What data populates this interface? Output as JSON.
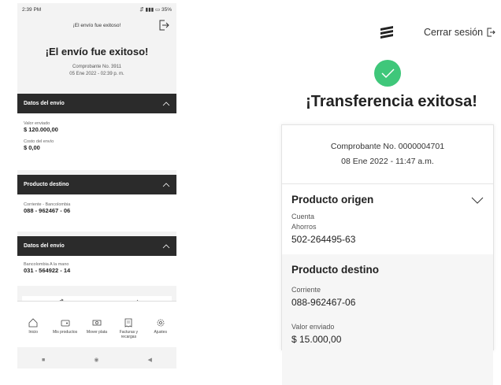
{
  "phone": {
    "status": {
      "time": "2:39 PM",
      "icons": "⇵ ▮▮▮ ▭ 35%"
    },
    "topbar_title": "¡El envío fue exitoso!",
    "title": "¡El envío fue exitoso!",
    "receipt": {
      "number": "Comprobante No. 3911",
      "date": "05 Ene 2022 - 02:39 p. m."
    },
    "sections": [
      {
        "title": "Datos del envío",
        "fields": [
          {
            "label": "Valor enviado",
            "value": "$ 120.000,00"
          },
          {
            "label": "Costo del envío",
            "value": "$ 0,00"
          }
        ]
      },
      {
        "title": "Producto destino",
        "fields": [
          {
            "label": "Corriente - Bancolombia",
            "value": "088 - 962467 - 06"
          }
        ]
      },
      {
        "title": "Datos del envío",
        "fields": [
          {
            "label": "Bancolombia A la mano",
            "value": "031 - 564922 - 14"
          }
        ]
      }
    ],
    "tabs": [
      {
        "label": "Inicio",
        "icon": "home-icon"
      },
      {
        "label": "Mis productos",
        "icon": "wallet-icon"
      },
      {
        "label": "Mover plata",
        "icon": "money-icon"
      },
      {
        "label": "Facturas y recargas",
        "icon": "bill-icon"
      },
      {
        "label": "Ajustes",
        "icon": "gear-icon"
      }
    ],
    "nav": [
      "■",
      "◉",
      "◀"
    ]
  },
  "web": {
    "logout_label": "Cerrar sesión",
    "title": "¡Transferencia exitosa!",
    "receipt": {
      "number": "Comprobante No. 0000004701",
      "date": "08 Ene 2022 - 11:47 a.m."
    },
    "origin": {
      "title": "Producto origen",
      "type1": "Cuenta",
      "type2": "Ahorros",
      "account": "502-264495-63"
    },
    "dest": {
      "title": "Producto destino",
      "type": "Corriente",
      "account": "088-962467-06",
      "amount_label": "Valor enviado",
      "amount": "$ 15.000,00"
    }
  },
  "colors": {
    "success": "#3fc77a",
    "dark_header": "#2b2b2b"
  }
}
